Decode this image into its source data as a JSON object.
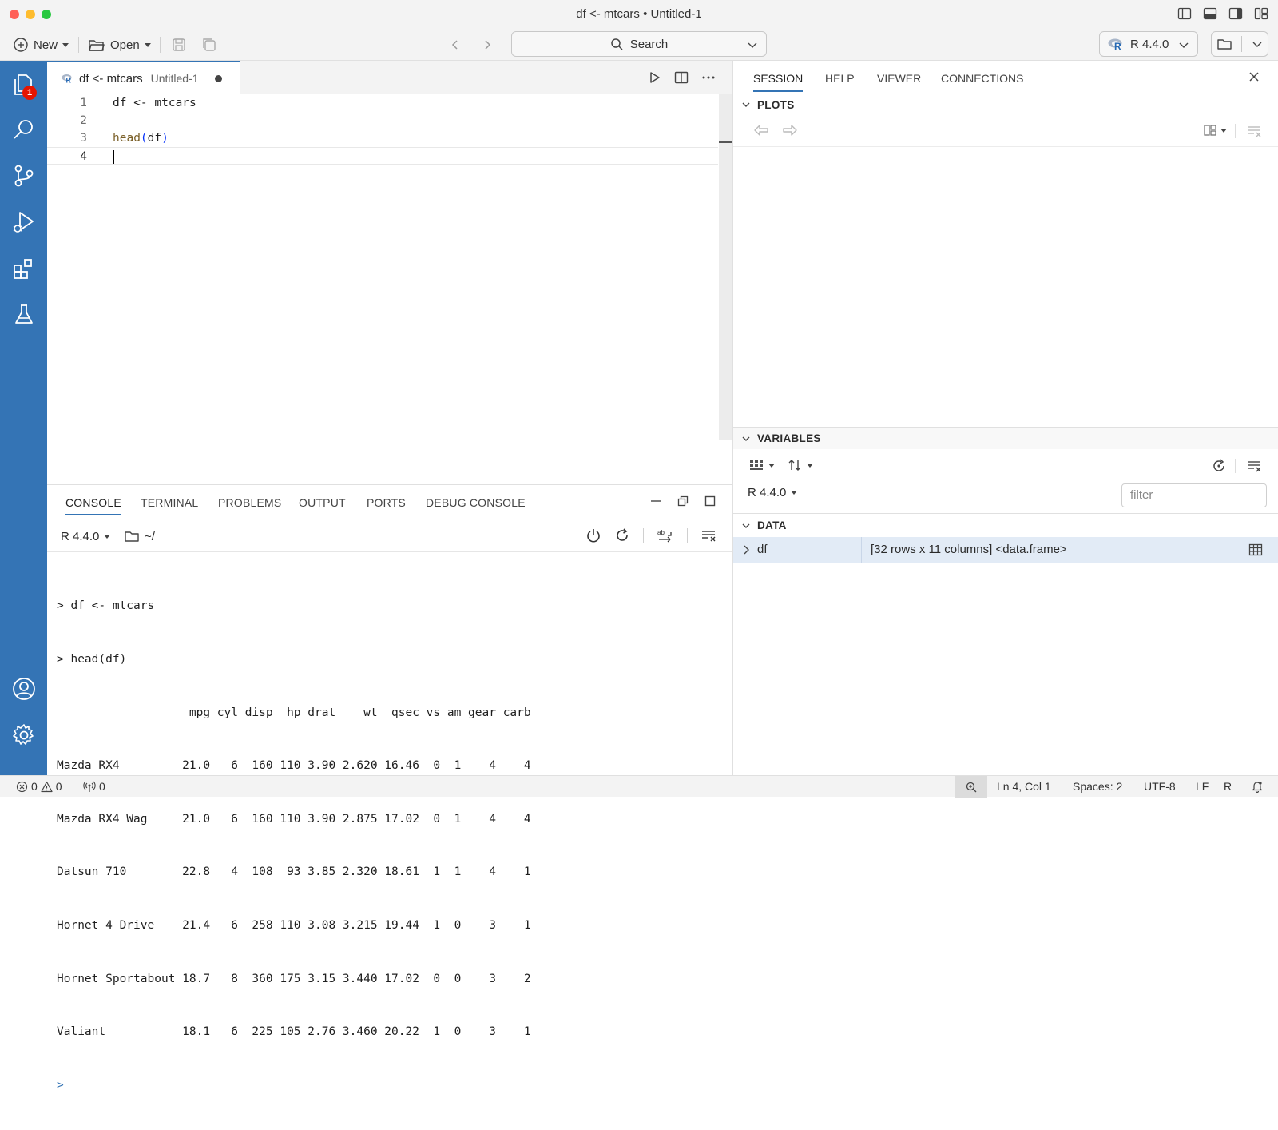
{
  "window": {
    "title": "df <- mtcars • Untitled-1"
  },
  "toolbar": {
    "new_label": "New",
    "open_label": "Open",
    "search_label": "Search",
    "interpreter_label": "R 4.4.0"
  },
  "activity": {
    "explorer_badge": "1"
  },
  "editor": {
    "tab_title": "df <- mtcars",
    "tab_subtitle": "Untitled-1",
    "lines": [
      {
        "num": "1",
        "text": "df <- mtcars"
      },
      {
        "num": "2",
        "text": ""
      },
      {
        "num": "3",
        "fn": "head",
        "open": "(",
        "arg": "df",
        "close": ")"
      },
      {
        "num": "4",
        "text": ""
      }
    ]
  },
  "panel": {
    "tabs": [
      "CONSOLE",
      "TERMINAL",
      "PROBLEMS",
      "OUTPUT",
      "PORTS",
      "DEBUG CONSOLE"
    ],
    "console_interpreter": "R 4.4.0",
    "console_dir": "~/",
    "console_lines": [
      "> df <- mtcars",
      "> head(df)",
      "                   mpg cyl disp  hp drat    wt  qsec vs am gear carb",
      "Mazda RX4         21.0   6  160 110 3.90 2.620 16.46  0  1    4    4",
      "Mazda RX4 Wag     21.0   6  160 110 3.90 2.875 17.02  0  1    4    4",
      "Datsun 710        22.8   4  108  93 3.85 2.320 18.61  1  1    4    1",
      "Hornet 4 Drive    21.4   6  258 110 3.08 3.215 19.44  1  0    3    1",
      "Hornet Sportabout 18.7   8  360 175 3.15 3.440 17.02  0  0    3    2",
      "Valiant           18.1   6  225 105 2.76 3.460 20.22  1  0    3    1"
    ],
    "prompt": ">"
  },
  "right": {
    "tabs": [
      "SESSION",
      "HELP",
      "VIEWER",
      "CONNECTIONS"
    ],
    "plots_title": "PLOTS",
    "variables_title": "VARIABLES",
    "vars_interpreter": "R 4.4.0",
    "filter_placeholder": "filter",
    "data_title": "DATA",
    "variable": {
      "name": "df",
      "value": "[32 rows x 11 columns] <data.frame>"
    }
  },
  "status": {
    "errors": "0",
    "warnings": "0",
    "ports": "0",
    "position": "Ln 4, Col 1",
    "spaces": "Spaces: 2",
    "encoding": "UTF-8",
    "eol": "LF",
    "language": "R"
  },
  "colors": {
    "accent": "#3474b5",
    "activity_bar": "#3474b5",
    "badge": "#e51400",
    "selected_row": "#e2ebf6"
  }
}
